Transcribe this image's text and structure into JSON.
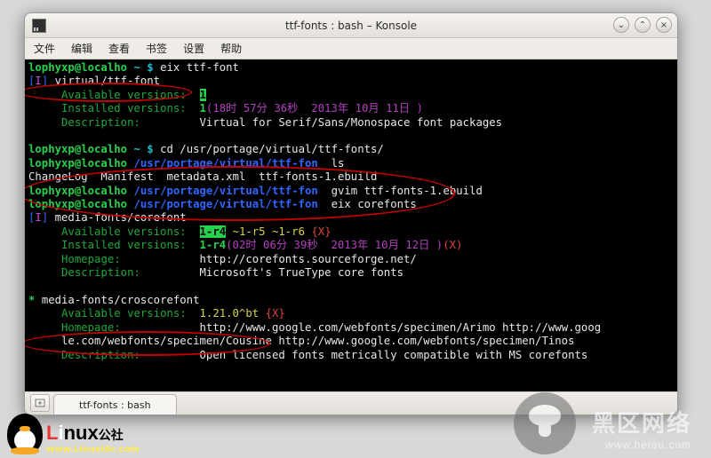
{
  "window": {
    "title": "ttf-fonts : bash – Konsole"
  },
  "menubar": {
    "file": "文件",
    "edit": "编辑",
    "view": "查看",
    "bookmarks": "书签",
    "settings": "设置",
    "help": "帮助"
  },
  "winbuttons": {
    "min": "⌄",
    "max": "⌃",
    "close": "×"
  },
  "tab": {
    "new_icon": "+",
    "label": "ttf-fonts : bash"
  },
  "term": {
    "prompt_user": "lophyxp@localho",
    "home_path": "~",
    "dollar": "$",
    "cmd1": "eix ttf-font",
    "pkg1_bracket_l": "[",
    "pkg1_flag": "I",
    "pkg1_bracket_r": "]",
    "pkg1_name": "virtual/ttf-font",
    "label_avail": "Available versions:",
    "pkg1_avail": "1",
    "label_inst": "Installed versions:",
    "pkg1_inst_ver": "1",
    "pkg1_inst_time": "(18时 57分 36秒  2013年 10月 11日 )",
    "label_desc": "Description:",
    "pkg1_desc": "Virtual for Serif/Sans/Monospace font packages",
    "cmd2": "cd /usr/portage/virtual/ttf-fonts/",
    "portage_path": "/usr/portage/virtual/ttf-fon",
    "cmd3": "ls",
    "ls_out": "ChangeLog  Manifest  metadata.xml  ttf-fonts-1.ebuild",
    "cmd4_a": "gvim",
    "cmd4_b": "ttf-fonts-1.ebuild",
    "cmd5": "eix corefonts",
    "pkg2_name": "media-fonts/corefont",
    "pkg2_avail_a": "1-r4",
    "pkg2_avail_b": " ~1-r5 ~1-r6 ",
    "pkg2_avail_c": "{X}",
    "pkg2_inst_ver": "1-r4",
    "pkg2_inst_time": "(02时 06分 39秒  2013年 10月 12日 )",
    "pkg2_inst_flags": "(X)",
    "label_home": "Homepage:",
    "pkg2_home": "http://corefonts.sourceforge.net/",
    "pkg2_desc": "Microsoft's TrueType core fonts",
    "pkg3_star": "*",
    "pkg3_name": "media-fonts/croscorefont",
    "pkg3_avail_a": "1.21.0^bt ",
    "pkg3_avail_b": "{X}",
    "pkg3_home": "http://www.google.com/webfonts/specimen/Arimo http://www.goog\n     le.com/webfonts/specimen/Cousine http://www.google.com/webfonts/specimen/Tinos",
    "pkg3_desc": "Open licensed fonts metrically compatible with MS corefonts"
  },
  "watermark": {
    "big": "黑区网络",
    "small": "www.heiqu.com"
  },
  "linuxidc": {
    "brand": "Linux",
    "suffix": "公社",
    "url": "www.Linuxidc.com"
  }
}
